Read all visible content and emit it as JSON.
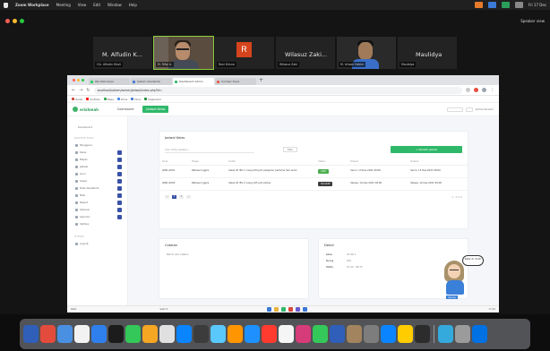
{
  "menubar": {
    "app": "Zoom Workplace",
    "items": [
      "Meeting",
      "View",
      "Edit",
      "Window",
      "Help"
    ],
    "right_text": "Fri 17 Dec"
  },
  "zoom": {
    "view_label": "Speaker view",
    "participants": [
      {
        "name": "M. Alfudin K...",
        "label": "Cik. Alfudin Kholi"
      },
      {
        "name": "",
        "label": "M. Rifqi A."
      },
      {
        "name": "",
        "label": "Ravi Krisna",
        "initial": "R"
      },
      {
        "name": "Wilasuz Zaki...",
        "label": "Wilasuz Zaki"
      },
      {
        "name": "",
        "label": "M. Ichsan Hakim"
      },
      {
        "name": "Maulidya",
        "label": "Maulidya"
      }
    ]
  },
  "browser": {
    "tabs": [
      "WA Web Kerja",
      "Sistem Akademik",
      "Dashboard Admin",
      "Sumber Daya"
    ],
    "url": "localhost/sistem/admin/jadwal/index.php?id=",
    "bookmarks": [
      "Gmail",
      "YouTube",
      "Maps",
      "Drive",
      "Docs",
      "Classroom"
    ],
    "status_left": "Ketik",
    "status_search": "Search",
    "clock": "17:22"
  },
  "app": {
    "logo": "erishmah",
    "tabs": [
      "Dashboard",
      "Jadwal Kelas"
    ],
    "user": "Administrator",
    "sidebar_head": "Dashboard",
    "sidebar_section": "MASTER DATA",
    "sidebar_items": [
      "Pengguna",
      "Kelas",
      "Mapel",
      "Jadwal",
      "Guru",
      "Siswa",
      "Data Akademik",
      "Nilai",
      "Raport",
      "Absensi",
      "Laporan",
      "Setting"
    ],
    "sidebar_footer_section": "OTHER",
    "sidebar_footer_item": "Logout",
    "main_card": {
      "title": "Jadwal Kelas",
      "search_placeholder": "Cari kode jadwal...",
      "filter_label": "Filter",
      "add_label": "+ Tambah Jadwal",
      "columns": [
        "Kode",
        "Mapel",
        "Detail",
        "Status",
        "Dibuat",
        "Diubah"
      ],
      "rows": [
        {
          "code": "JDWL-0001",
          "subject": "Bahasa Inggris",
          "detail": "Kelas XII IPA 1 ruang 204 jam pelajaran pertama hari senin",
          "status": "Aktif",
          "created": "Senin, 13 Des 2021 08:00",
          "updated": "Senin, 13 Des 2021 08:00"
        },
        {
          "code": "JDWL-0002",
          "subject": "Bahasa Inggris",
          "detail": "Kelas XII IPS 2 ruang 105 jam kedua",
          "status": "Nonaktif",
          "created": "Selasa, 14 Des 2021 09:00",
          "updated": "Selasa, 14 Des 2021 09:00"
        }
      ],
      "pager": [
        "1",
        "2"
      ],
      "pager_info": "1 - 2 of 2"
    },
    "small_card_left": {
      "title": "Catatan",
      "text": "Belum ada catatan"
    },
    "small_card_right": {
      "title": "Detail",
      "rows": [
        {
          "k": "Kelas",
          "v": "XII IPA 1"
        },
        {
          "k": "Ruang",
          "v": "204"
        },
        {
          "k": "Waktu",
          "v": "07.00 - 08.30"
        }
      ]
    }
  },
  "sticker": {
    "bubble": "Ketik di chat!",
    "name": "Ajeng"
  },
  "colors": {
    "accent_green": "#2fb86a",
    "indigo": "#3951a8",
    "zoom_bg": "#141414"
  }
}
